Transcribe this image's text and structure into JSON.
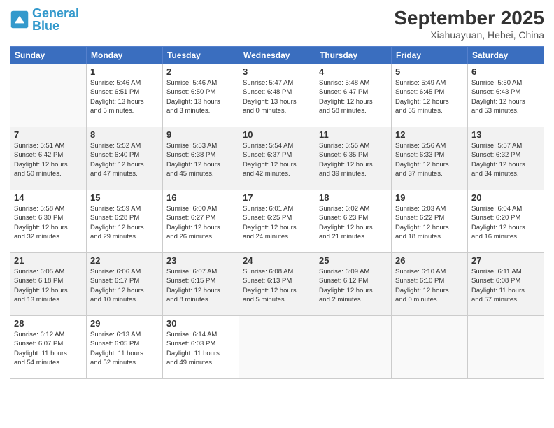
{
  "logo": {
    "line1": "General",
    "line2": "Blue"
  },
  "title": "September 2025",
  "subtitle": "Xiahuayuan, Hebei, China",
  "days_of_week": [
    "Sunday",
    "Monday",
    "Tuesday",
    "Wednesday",
    "Thursday",
    "Friday",
    "Saturday"
  ],
  "weeks": [
    [
      {
        "day": "",
        "info": ""
      },
      {
        "day": "1",
        "info": "Sunrise: 5:46 AM\nSunset: 6:51 PM\nDaylight: 13 hours\nand 5 minutes."
      },
      {
        "day": "2",
        "info": "Sunrise: 5:46 AM\nSunset: 6:50 PM\nDaylight: 13 hours\nand 3 minutes."
      },
      {
        "day": "3",
        "info": "Sunrise: 5:47 AM\nSunset: 6:48 PM\nDaylight: 13 hours\nand 0 minutes."
      },
      {
        "day": "4",
        "info": "Sunrise: 5:48 AM\nSunset: 6:47 PM\nDaylight: 12 hours\nand 58 minutes."
      },
      {
        "day": "5",
        "info": "Sunrise: 5:49 AM\nSunset: 6:45 PM\nDaylight: 12 hours\nand 55 minutes."
      },
      {
        "day": "6",
        "info": "Sunrise: 5:50 AM\nSunset: 6:43 PM\nDaylight: 12 hours\nand 53 minutes."
      }
    ],
    [
      {
        "day": "7",
        "info": "Sunrise: 5:51 AM\nSunset: 6:42 PM\nDaylight: 12 hours\nand 50 minutes."
      },
      {
        "day": "8",
        "info": "Sunrise: 5:52 AM\nSunset: 6:40 PM\nDaylight: 12 hours\nand 47 minutes."
      },
      {
        "day": "9",
        "info": "Sunrise: 5:53 AM\nSunset: 6:38 PM\nDaylight: 12 hours\nand 45 minutes."
      },
      {
        "day": "10",
        "info": "Sunrise: 5:54 AM\nSunset: 6:37 PM\nDaylight: 12 hours\nand 42 minutes."
      },
      {
        "day": "11",
        "info": "Sunrise: 5:55 AM\nSunset: 6:35 PM\nDaylight: 12 hours\nand 39 minutes."
      },
      {
        "day": "12",
        "info": "Sunrise: 5:56 AM\nSunset: 6:33 PM\nDaylight: 12 hours\nand 37 minutes."
      },
      {
        "day": "13",
        "info": "Sunrise: 5:57 AM\nSunset: 6:32 PM\nDaylight: 12 hours\nand 34 minutes."
      }
    ],
    [
      {
        "day": "14",
        "info": "Sunrise: 5:58 AM\nSunset: 6:30 PM\nDaylight: 12 hours\nand 32 minutes."
      },
      {
        "day": "15",
        "info": "Sunrise: 5:59 AM\nSunset: 6:28 PM\nDaylight: 12 hours\nand 29 minutes."
      },
      {
        "day": "16",
        "info": "Sunrise: 6:00 AM\nSunset: 6:27 PM\nDaylight: 12 hours\nand 26 minutes."
      },
      {
        "day": "17",
        "info": "Sunrise: 6:01 AM\nSunset: 6:25 PM\nDaylight: 12 hours\nand 24 minutes."
      },
      {
        "day": "18",
        "info": "Sunrise: 6:02 AM\nSunset: 6:23 PM\nDaylight: 12 hours\nand 21 minutes."
      },
      {
        "day": "19",
        "info": "Sunrise: 6:03 AM\nSunset: 6:22 PM\nDaylight: 12 hours\nand 18 minutes."
      },
      {
        "day": "20",
        "info": "Sunrise: 6:04 AM\nSunset: 6:20 PM\nDaylight: 12 hours\nand 16 minutes."
      }
    ],
    [
      {
        "day": "21",
        "info": "Sunrise: 6:05 AM\nSunset: 6:18 PM\nDaylight: 12 hours\nand 13 minutes."
      },
      {
        "day": "22",
        "info": "Sunrise: 6:06 AM\nSunset: 6:17 PM\nDaylight: 12 hours\nand 10 minutes."
      },
      {
        "day": "23",
        "info": "Sunrise: 6:07 AM\nSunset: 6:15 PM\nDaylight: 12 hours\nand 8 minutes."
      },
      {
        "day": "24",
        "info": "Sunrise: 6:08 AM\nSunset: 6:13 PM\nDaylight: 12 hours\nand 5 minutes."
      },
      {
        "day": "25",
        "info": "Sunrise: 6:09 AM\nSunset: 6:12 PM\nDaylight: 12 hours\nand 2 minutes."
      },
      {
        "day": "26",
        "info": "Sunrise: 6:10 AM\nSunset: 6:10 PM\nDaylight: 12 hours\nand 0 minutes."
      },
      {
        "day": "27",
        "info": "Sunrise: 6:11 AM\nSunset: 6:08 PM\nDaylight: 11 hours\nand 57 minutes."
      }
    ],
    [
      {
        "day": "28",
        "info": "Sunrise: 6:12 AM\nSunset: 6:07 PM\nDaylight: 11 hours\nand 54 minutes."
      },
      {
        "day": "29",
        "info": "Sunrise: 6:13 AM\nSunset: 6:05 PM\nDaylight: 11 hours\nand 52 minutes."
      },
      {
        "day": "30",
        "info": "Sunrise: 6:14 AM\nSunset: 6:03 PM\nDaylight: 11 hours\nand 49 minutes."
      },
      {
        "day": "",
        "info": ""
      },
      {
        "day": "",
        "info": ""
      },
      {
        "day": "",
        "info": ""
      },
      {
        "day": "",
        "info": ""
      }
    ]
  ]
}
